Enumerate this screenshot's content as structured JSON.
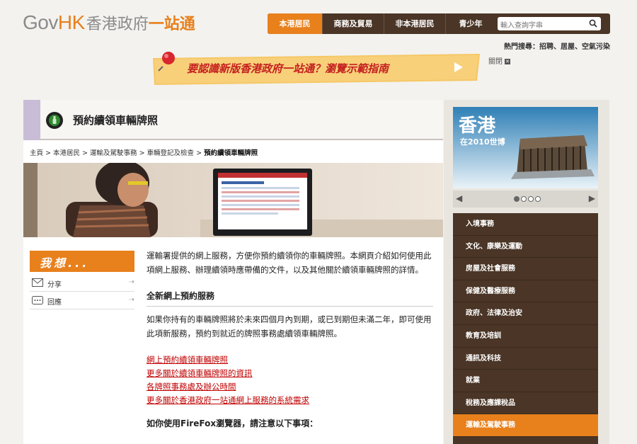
{
  "logo": {
    "gov": "Gov",
    "hk": "HK",
    "zh_a": "香港政府",
    "zh_b": "一站通"
  },
  "nav": {
    "tabs": [
      "本港居民",
      "商務及貿易",
      "非本港居民",
      "青少年"
    ],
    "active_index": 0
  },
  "search": {
    "placeholder": "輸入查詢字串"
  },
  "hot_search": {
    "label": "熱門搜尋：",
    "items": "招聘、居屋、空氣污染"
  },
  "banner": {
    "text": "要認識新版香港政府一站通？瀏覽示範指南"
  },
  "close": {
    "label": "關閉"
  },
  "page": {
    "title": "預約續領車輛牌照",
    "breadcrumb": {
      "items": [
        "主頁",
        "本港居民",
        "運輸及駕駛事務",
        "車輛登記及檢查"
      ],
      "current": "預約續領車輛牌照",
      "separator": " > "
    }
  },
  "sidebar": {
    "heading": "我想...",
    "items": [
      {
        "label": "分享",
        "icon": "mail-icon"
      },
      {
        "label": "回應",
        "icon": "comment-icon"
      }
    ]
  },
  "content": {
    "intro": "運輸署提供的網上服務，方便你預約續領你的車輛牌照。本網頁介紹如何使用此項網上服務、辦理續領時應帶備的文件，以及其他關於續領車輛牌照的詳情。",
    "section1_title": "全新網上預約服務",
    "section1_body": "如果你持有的車輛牌照將於未來四個月內到期，或已到期但未滿二年，即可使用此項新服務，預約到就近的牌照事務處續領車輛牌照。",
    "links": [
      "網上預約續領車輛牌照",
      "更多關於續領車輛牌照的資訊",
      "各牌照事務處及辦公時間",
      "更多關於香港政府一站通網上服務的系統需求"
    ],
    "section2_title": "如你使用FireFox瀏覽器，請注意以下事項："
  },
  "promo": {
    "line1": "香港",
    "line2": "在2010世博",
    "dots": 4,
    "active_dot": 0
  },
  "categories": {
    "items": [
      "入境事務",
      "文化、康樂及運動",
      "房屋及社會服務",
      "保健及醫療服務",
      "政府、法律及治安",
      "教育及培訓",
      "通訊及科技",
      "就業",
      "稅務及應課稅品",
      "運輸及駕駛事務"
    ],
    "active_index": 9
  },
  "colors": {
    "accent": "#e8801c",
    "dark_brown": "#4a3526",
    "link_red": "#c00000"
  }
}
